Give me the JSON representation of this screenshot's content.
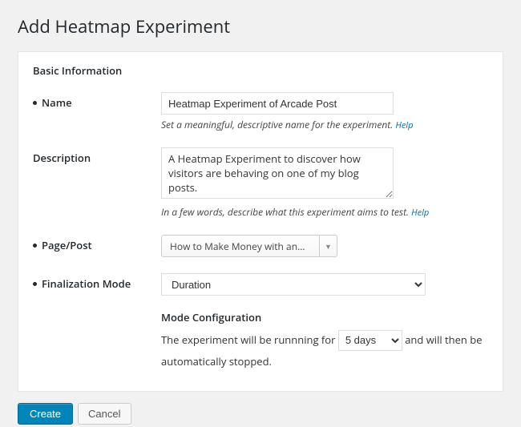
{
  "page": {
    "title": "Add Heatmap Experiment"
  },
  "section": {
    "heading": "Basic Information"
  },
  "fields": {
    "name": {
      "label": "Name",
      "value": "Heatmap Experiment of Arcade Post",
      "hint": "Set a meaningful, descriptive name for the experiment.",
      "help": "Help"
    },
    "description": {
      "label": "Description",
      "value": "A Heatmap Experiment to discover how visitors are behaving on one of my blog posts.",
      "hint": "In a few words, describe what this experiment aims to test.",
      "help": "Help"
    },
    "page_post": {
      "label": "Page/Post",
      "selected": "How to Make Money with an…"
    },
    "finalization": {
      "label": "Finalization Mode",
      "selected": "Duration"
    },
    "mode_config": {
      "title": "Mode Configuration",
      "text_before": "The experiment will be runnning for",
      "duration_value": "5 days",
      "text_after": "and will then be automatically stopped."
    }
  },
  "actions": {
    "create": "Create",
    "cancel": "Cancel"
  }
}
